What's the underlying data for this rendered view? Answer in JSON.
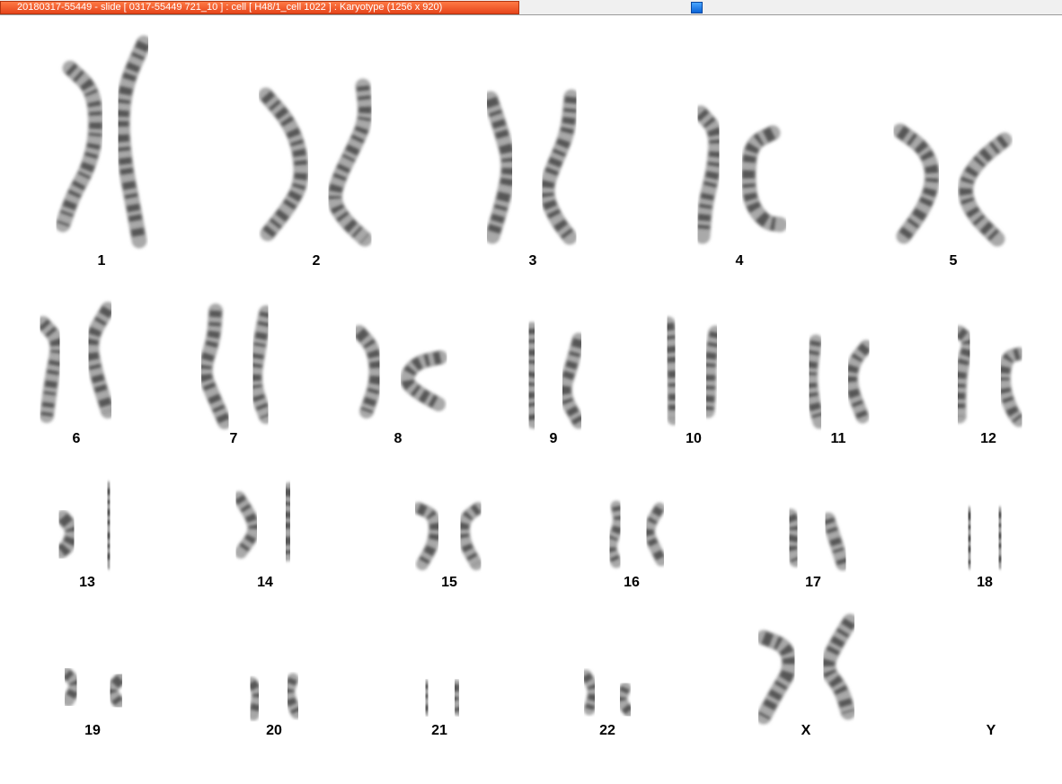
{
  "window": {
    "title": "20180317-55449 - slide [ 0317-55449 721_10 ] : cell [ H48/1_cell 1022 ] : Karyotype  (1256 x 920)"
  },
  "karyotype": {
    "chromosomes": [
      {
        "label": "1"
      },
      {
        "label": "2"
      },
      {
        "label": "3"
      },
      {
        "label": "4"
      },
      {
        "label": "5"
      },
      {
        "label": "6"
      },
      {
        "label": "7"
      },
      {
        "label": "8"
      },
      {
        "label": "9"
      },
      {
        "label": "10"
      },
      {
        "label": "11"
      },
      {
        "label": "12"
      },
      {
        "label": "13"
      },
      {
        "label": "14"
      },
      {
        "label": "15"
      },
      {
        "label": "16"
      },
      {
        "label": "17"
      },
      {
        "label": "18"
      },
      {
        "label": "19"
      },
      {
        "label": "20"
      },
      {
        "label": "21"
      },
      {
        "label": "22"
      },
      {
        "label": "X"
      },
      {
        "label": "Y"
      }
    ]
  }
}
